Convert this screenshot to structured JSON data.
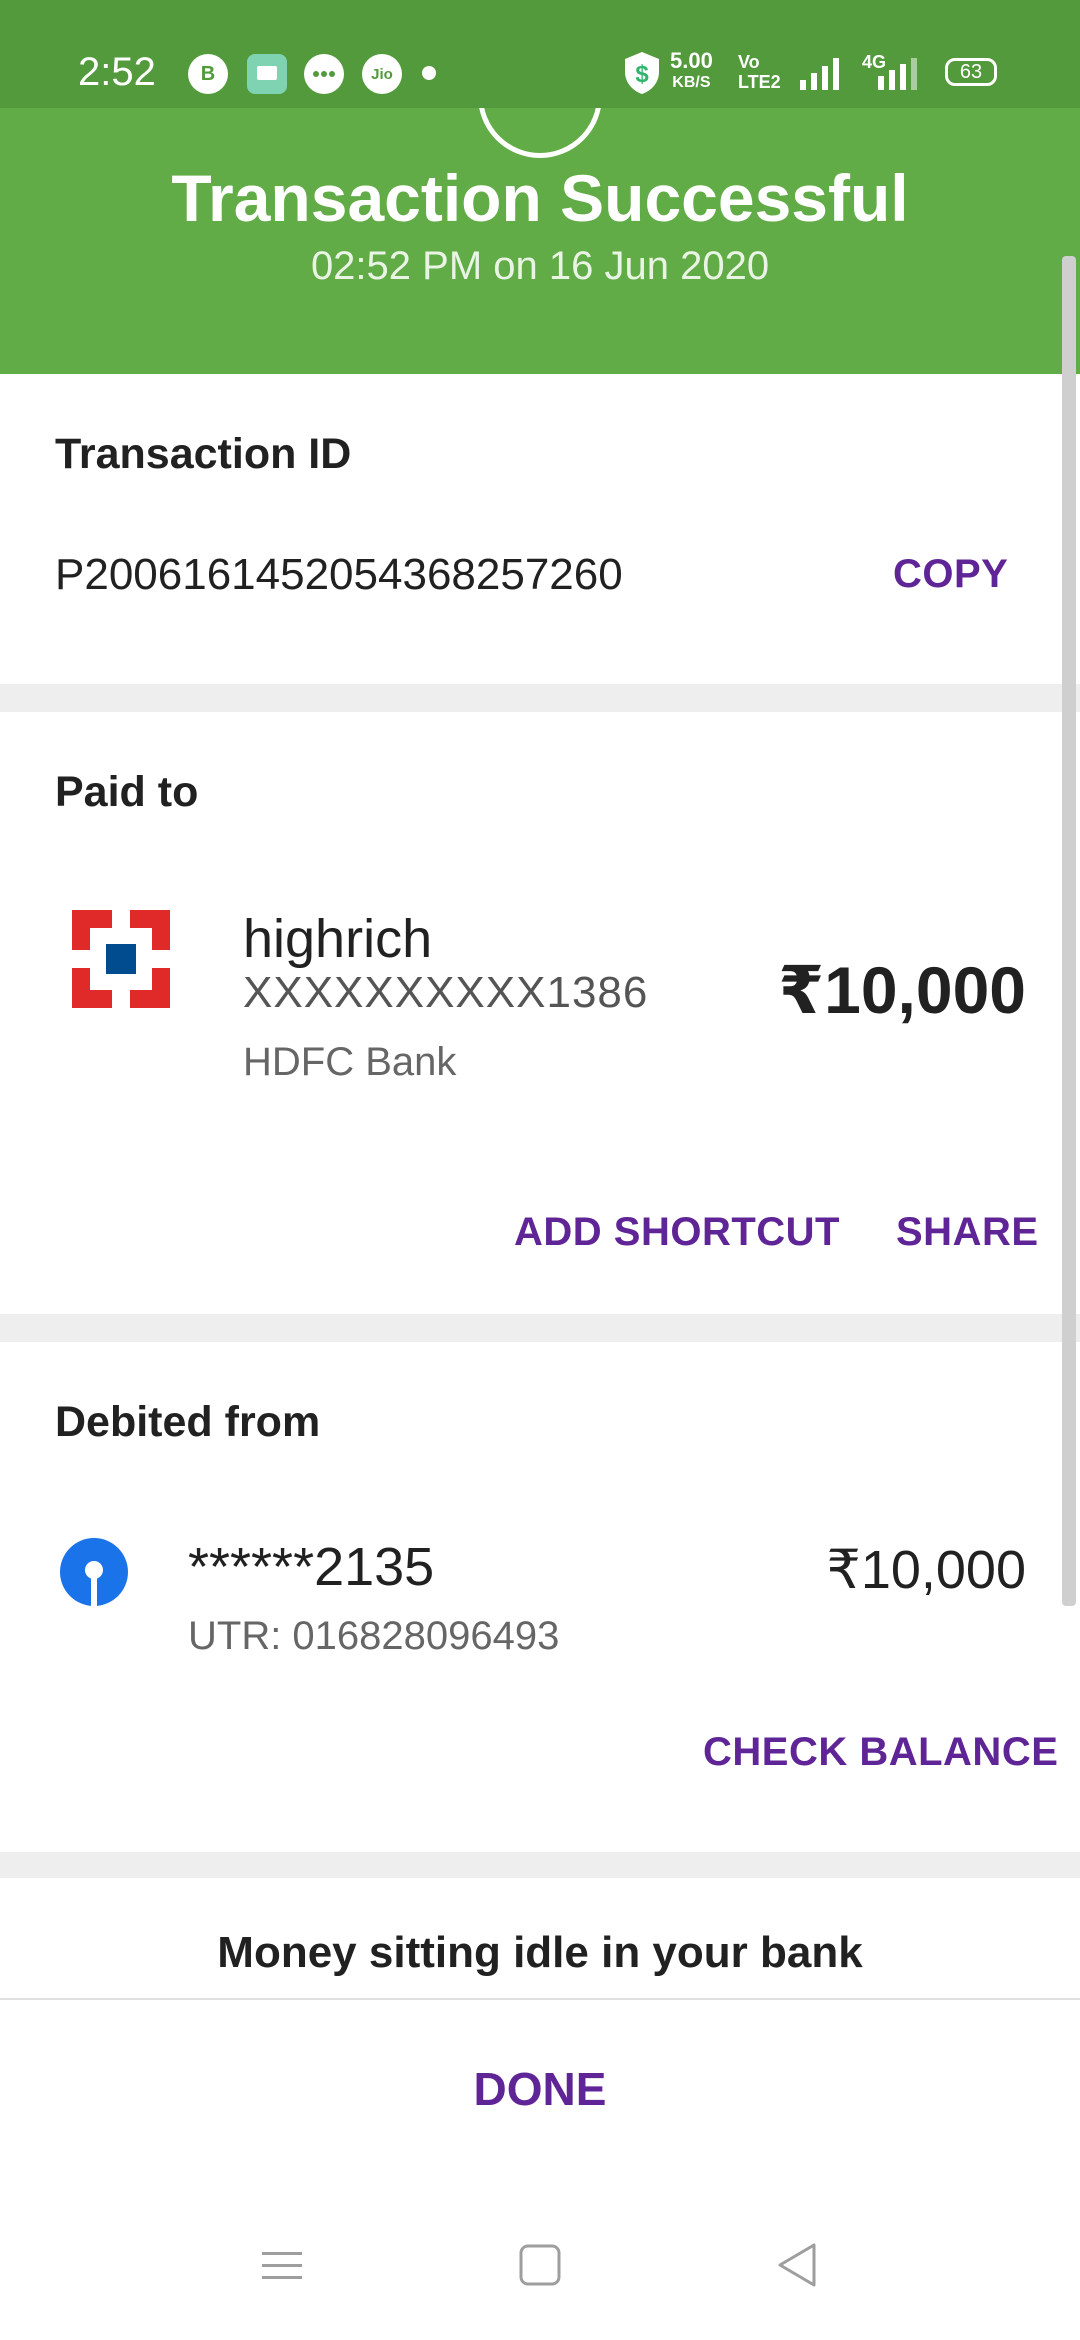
{
  "status_bar": {
    "time": "2:52",
    "notification_icons": [
      "b-icon",
      "messages-icon",
      "chat-icon",
      "jio-icon"
    ],
    "jio_label": "Jio",
    "b_label": "B",
    "net_speed": "5.00",
    "net_speed_unit": "KB/S",
    "volte_label": "Vo",
    "volte_sub": "LTE2",
    "network_label": "4G",
    "battery": "63"
  },
  "header": {
    "title": "Transaction Successful",
    "subtitle": "02:52 PM on 16 Jun 2020",
    "bg_color": "#62ac47"
  },
  "transaction": {
    "title": "Transaction ID",
    "id": "P2006161452054368257260",
    "copy_label": "COPY"
  },
  "paid_to": {
    "title": "Paid to",
    "name": "highrich",
    "account": "XXXXXXXXXX1386",
    "bank": "HDFC Bank",
    "amount": "₹10,000",
    "add_shortcut_label": "ADD SHORTCUT",
    "share_label": "SHARE"
  },
  "debited_from": {
    "title": "Debited from",
    "account": "******2135",
    "utr": "UTR: 016828096493",
    "amount": "₹10,000",
    "check_balance_label": "CHECK BALANCE"
  },
  "promo": {
    "text": "Money sitting idle in your bank"
  },
  "footer": {
    "done_label": "DONE"
  },
  "nav_bar": {
    "icons": [
      "menu-icon",
      "home-square-icon",
      "back-triangle-icon"
    ]
  },
  "colors": {
    "accent": "#5f2596",
    "status_bar": "#529a3b",
    "hdfc_red": "#e02a2a",
    "hdfc_blue": "#004c8f",
    "sbi_blue": "#1a73e8"
  }
}
